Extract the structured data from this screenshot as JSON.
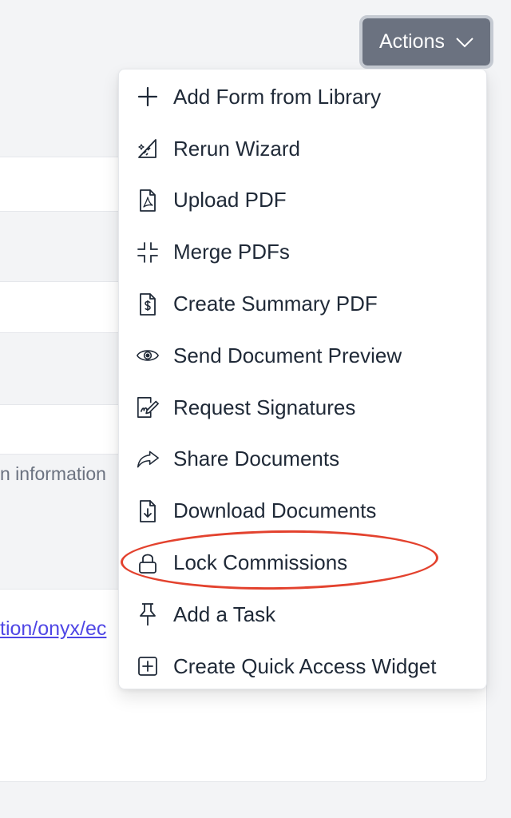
{
  "background": {
    "help_text": "n information",
    "link_text": "tion/onyx/ec"
  },
  "actions_button": {
    "label": "Actions",
    "icon": "chevron-down-icon"
  },
  "menu": {
    "items": [
      {
        "label": "Add Form from Library",
        "icon": "plus-icon"
      },
      {
        "label": "Rerun Wizard",
        "icon": "wizard-hat-icon"
      },
      {
        "label": "Upload PDF",
        "icon": "pdf-file-icon"
      },
      {
        "label": "Merge PDFs",
        "icon": "merge-arrows-icon"
      },
      {
        "label": "Create Summary PDF",
        "icon": "dollar-document-icon"
      },
      {
        "label": "Send Document Preview",
        "icon": "eye-icon"
      },
      {
        "label": "Request Signatures",
        "icon": "signature-icon"
      },
      {
        "label": "Share Documents",
        "icon": "share-arrow-icon"
      },
      {
        "label": "Download Documents",
        "icon": "download-document-icon"
      },
      {
        "label": "Lock Commissions",
        "icon": "lock-icon"
      },
      {
        "label": "Add a Task",
        "icon": "pushpin-icon"
      },
      {
        "label": "Create Quick Access Widget",
        "icon": "plus-square-icon"
      }
    ]
  },
  "colors": {
    "button_bg": "#6b7280",
    "link": "#4f46e5",
    "annotation": "#e3422e"
  }
}
